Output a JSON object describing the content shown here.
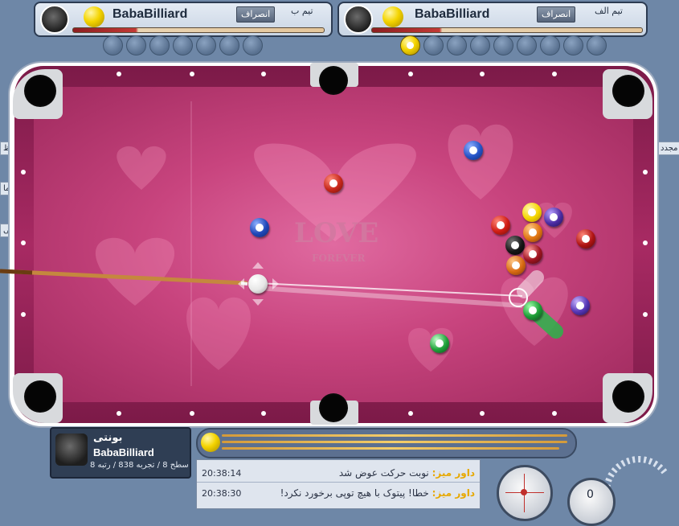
{
  "players": {
    "left": {
      "name": "BabaBilliard",
      "forfeit_label": "انصراف",
      "team_label": "تیم ب"
    },
    "right": {
      "name": "BabaBilliard",
      "forfeit_label": "انصراف",
      "team_label": "تیم الف"
    }
  },
  "pocketed": {
    "left_slots": 7,
    "right_slots": 9,
    "right_first_ball": "1"
  },
  "table": {
    "logo_title": "LOVE",
    "logo_subtitle": "FOREVER",
    "felt_color": "#c8447e",
    "rail_color": "#a82a63"
  },
  "side_tabs": {
    "left_top": "تنظ",
    "left_mid1": "ما",
    "left_mid2": "بی",
    "right_top": "مجدد"
  },
  "profile": {
    "display_name": "بونتی",
    "username": "BabaBilliard",
    "stats": "سطح 8 / تجربه 838 / رتبه 8"
  },
  "chat": [
    {
      "time": "20:38:14",
      "speaker": "داور میز:",
      "text": "نوبت حرکت عوض شد"
    },
    {
      "time": "20:38:30",
      "speaker": "داور میز:",
      "text": "خطا! پیتوک با هیچ توپی برخورد نکرد!"
    }
  ],
  "controls": {
    "power_label": "0"
  },
  "icons": {
    "avatar": "cat-avatar-icon",
    "ball": "yellow-ball-icon",
    "spin": "cue-ball-spin-icon"
  }
}
